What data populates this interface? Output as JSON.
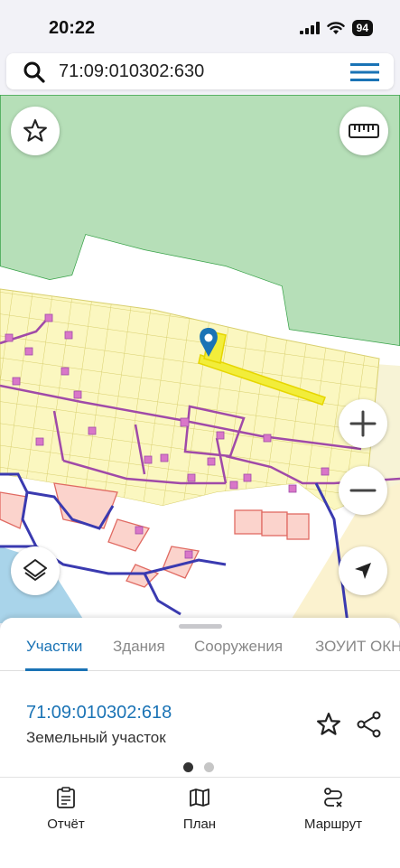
{
  "status_bar": {
    "time": "20:22",
    "battery": "94"
  },
  "search": {
    "value": "71:09:010302:630"
  },
  "map_controls": {
    "favorite": "star-icon",
    "measure": "ruler-icon",
    "zoom_in": "plus-icon",
    "zoom_out": "minus-icon",
    "layers": "layers-icon",
    "locate": "location-arrow-icon"
  },
  "colors": {
    "accent": "#1a73b5",
    "forest": "#b6dfb8",
    "parcels": "#fbf7c0",
    "water": "#a9d4ea",
    "selected": "#f2ed3a"
  },
  "sheet": {
    "tabs": [
      {
        "label": "Участки",
        "active": true
      },
      {
        "label": "Здания",
        "active": false
      },
      {
        "label": "Сооружения",
        "active": false
      },
      {
        "label": "ЗОУИТ ОКН",
        "active": false
      }
    ],
    "result": {
      "number": "71:09:010302:618",
      "type": "Земельный участок"
    },
    "pager": {
      "pages": 2,
      "current": 1
    }
  },
  "bottom_nav": {
    "items": [
      {
        "label": "Отчёт",
        "icon": "report-icon"
      },
      {
        "label": "План",
        "icon": "map-icon"
      },
      {
        "label": "Маршрут",
        "icon": "route-icon"
      }
    ]
  }
}
